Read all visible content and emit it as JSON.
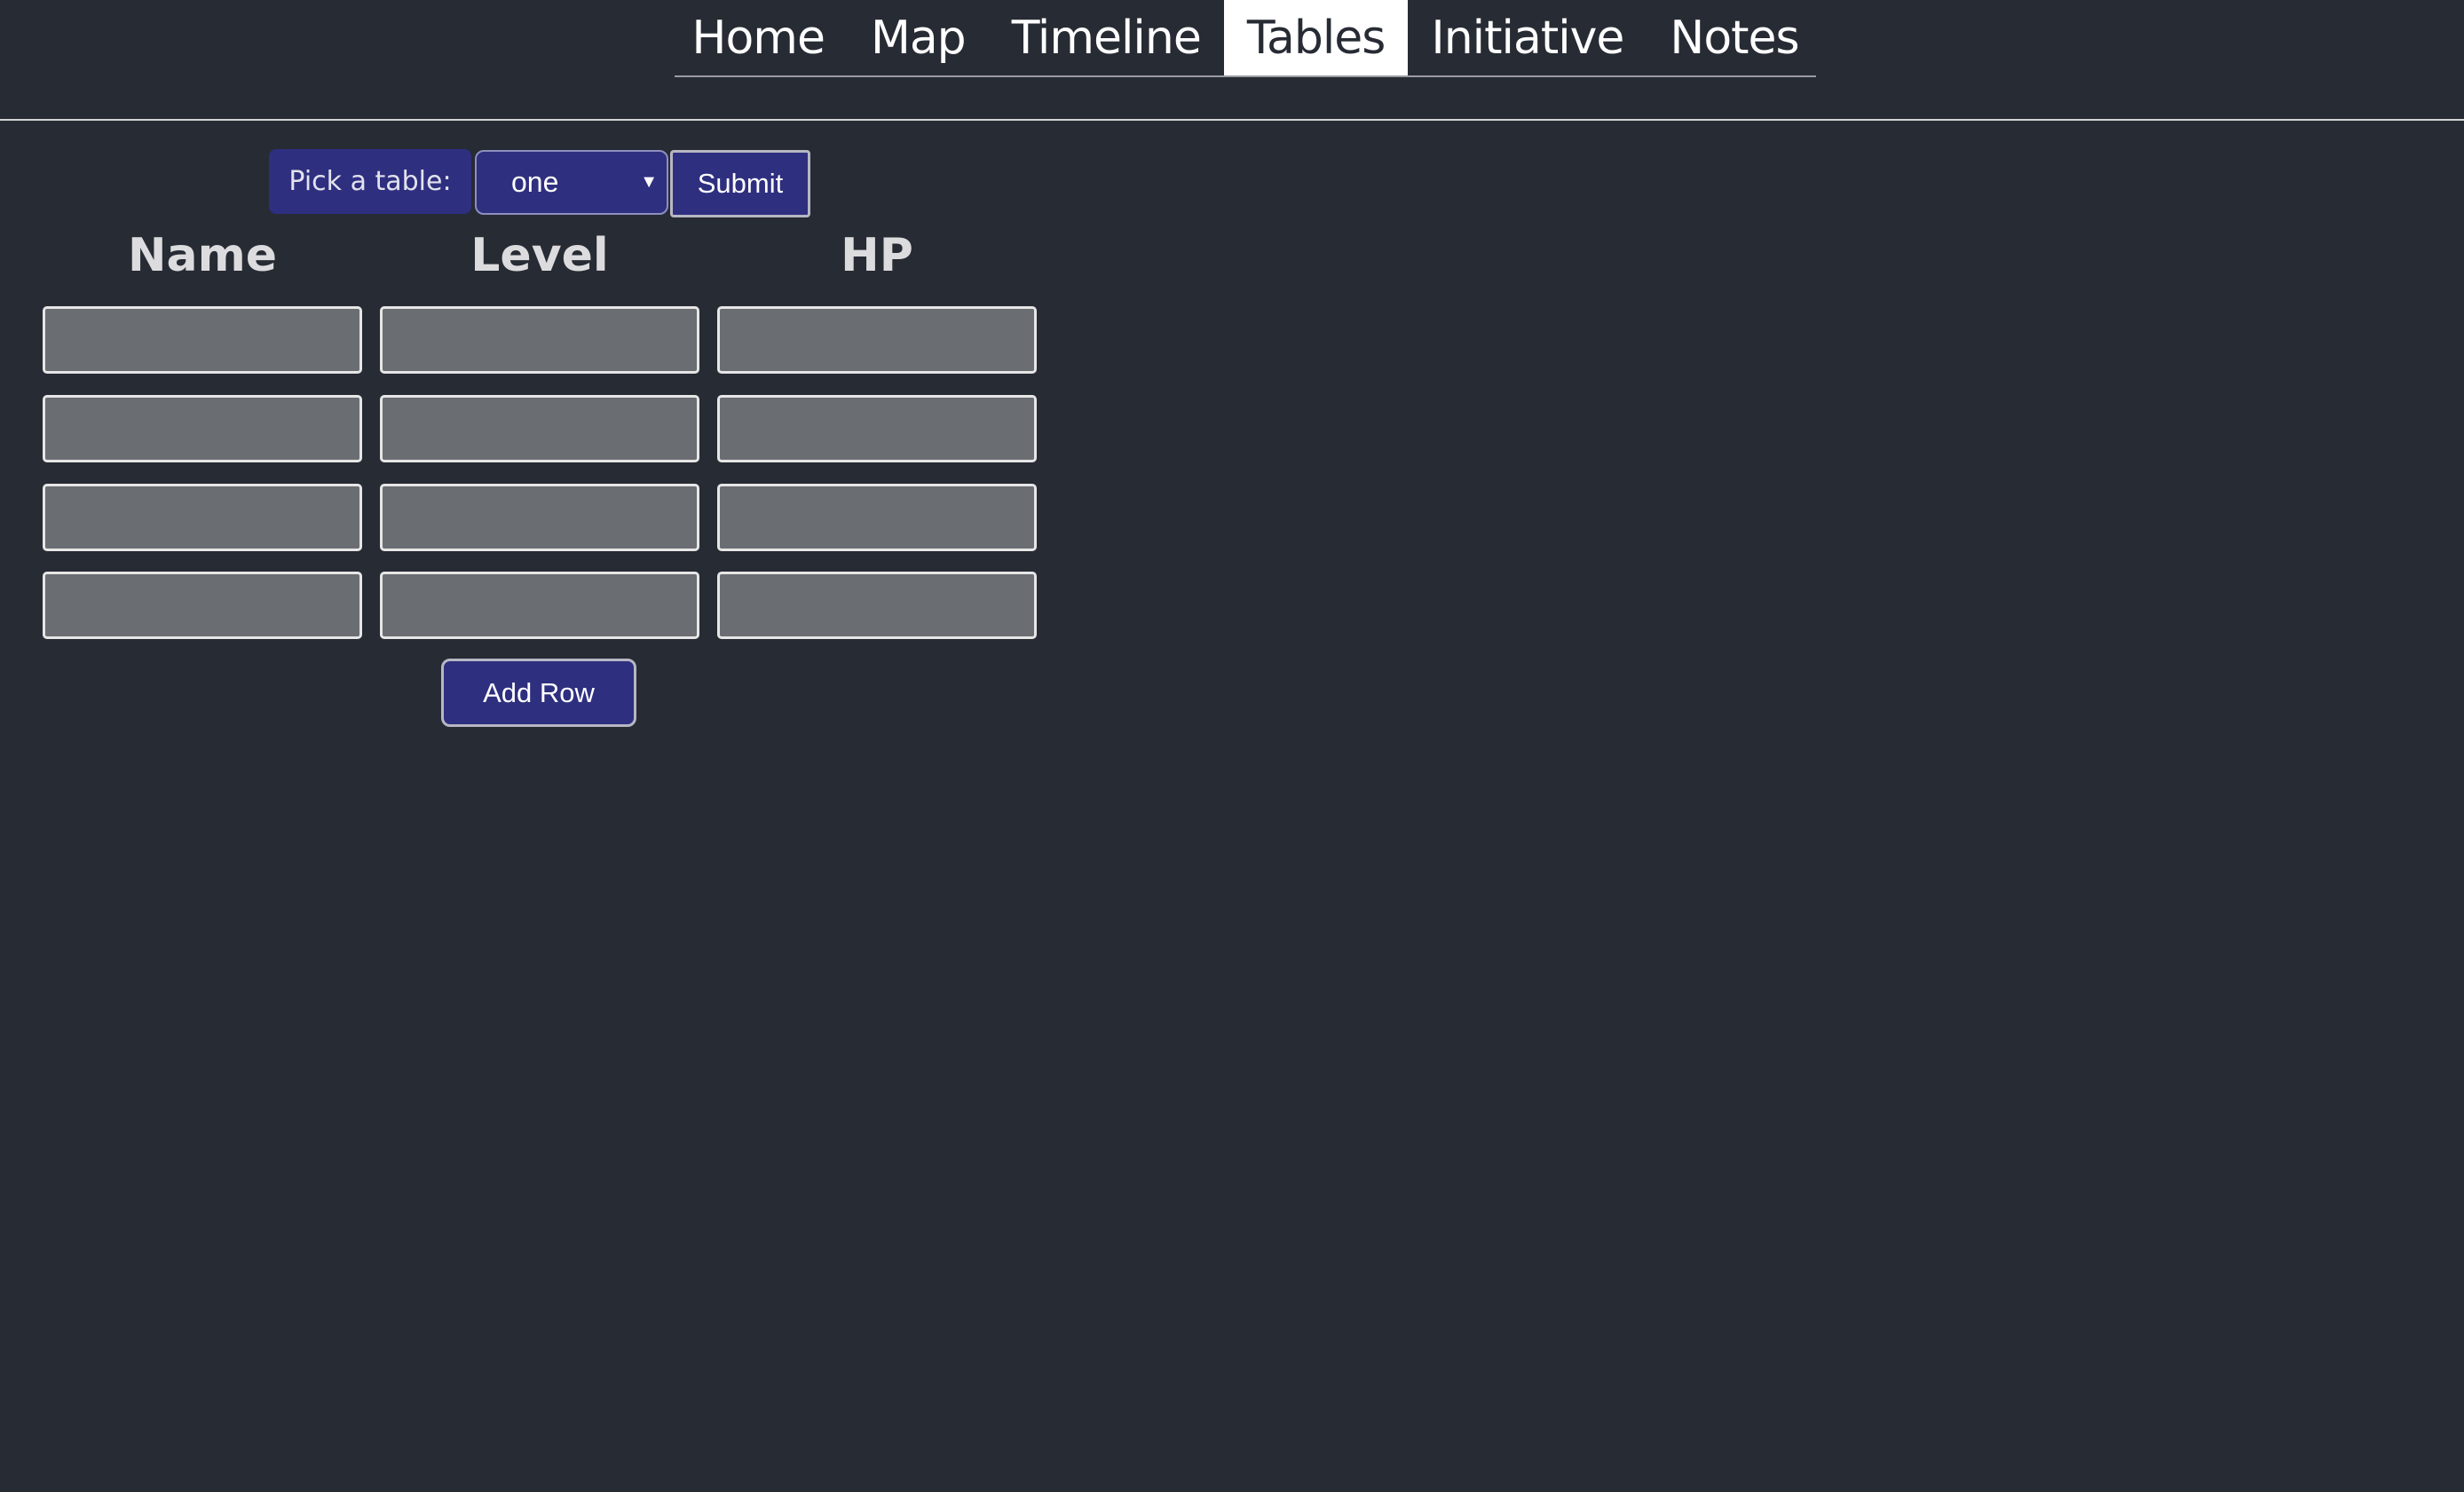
{
  "nav": {
    "tabs": [
      {
        "label": "Home",
        "active": false
      },
      {
        "label": "Map",
        "active": false
      },
      {
        "label": "Timeline",
        "active": false
      },
      {
        "label": "Tables",
        "active": true
      },
      {
        "label": "Initiative",
        "active": false
      },
      {
        "label": "Notes",
        "active": false
      }
    ]
  },
  "picker": {
    "label": "Pick a table:",
    "selected": "one",
    "submit_label": "Submit"
  },
  "table": {
    "headers": [
      "Name",
      "Level",
      "HP"
    ],
    "rows": [
      [
        "",
        "",
        ""
      ],
      [
        "",
        "",
        ""
      ],
      [
        "",
        "",
        ""
      ],
      [
        "",
        "",
        ""
      ]
    ],
    "add_row_label": "Add Row"
  },
  "colors": {
    "background": "#272b34",
    "accent": "#2f2f80",
    "input_bg": "#6a6d72"
  }
}
